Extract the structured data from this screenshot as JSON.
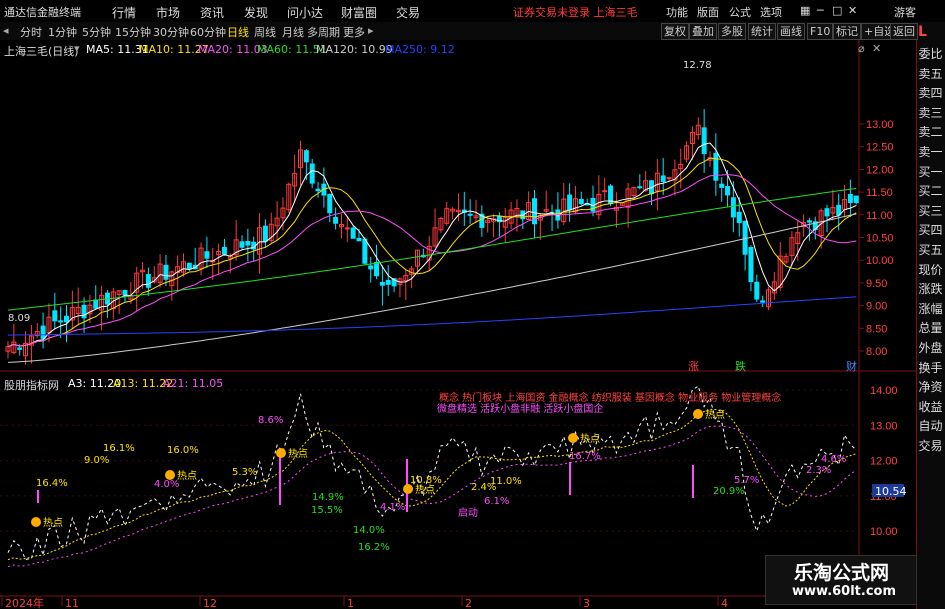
{
  "menubar": {
    "app_title": "通达信金融终端",
    "menus": [
      "行情",
      "市场",
      "资讯",
      "发现",
      "问小达",
      "财富圈",
      "交易"
    ],
    "warn": "证券交易未登录  上海三毛",
    "right": [
      "功能",
      "版面",
      "公式",
      "选项"
    ],
    "guest": "游客"
  },
  "periods": [
    "分时",
    "1分钟",
    "5分钟",
    "15分钟",
    "30分钟",
    "60分钟",
    "日线",
    "周线",
    "月线",
    "多周期",
    "更多"
  ],
  "active_period": "日线",
  "toolbar_right": [
    "复权",
    "叠加",
    "多股",
    "统计",
    "画线",
    "F10",
    "标记",
    "+自选",
    "返回"
  ],
  "side_panel": {
    "top_label": "L",
    "items": [
      "委比",
      "卖五",
      "卖四",
      "卖三",
      "卖二",
      "卖一",
      "买一",
      "买二",
      "买三",
      "买四",
      "买五",
      "现价",
      "涨跌",
      "涨幅",
      "总量",
      "外盘",
      "换手",
      "净资",
      "收益",
      "自动",
      "交易"
    ]
  },
  "main_chart": {
    "stock": "上海三毛(日线)",
    "ma_labels": [
      {
        "text": "MA5: 11.31",
        "color": "#ffffff"
      },
      {
        "text": "MA10: 11.27",
        "color": "#ffe100"
      },
      {
        "text": "MA20: 11.03",
        "color": "#ff4cff"
      },
      {
        "text": "MA60: 11.51",
        "color": "#22dd22"
      },
      {
        "text": "MA120: 10.99",
        "color": "#cccccc"
      },
      {
        "text": "MA250: 9.12",
        "color": "#2244ff"
      }
    ],
    "y_ticks": [
      "13.00",
      "12.50",
      "12.00",
      "11.50",
      "11.00",
      "10.50",
      "10.00",
      "9.50",
      "9.00",
      "8.50",
      "8.00"
    ],
    "high_label": "12.78",
    "low_label": "8.09",
    "markers": [
      "涨",
      "跌",
      "财"
    ]
  },
  "indicator": {
    "title": "股朋指标网",
    "labels": [
      {
        "text": "A3: 11.20",
        "color": "#ffffff"
      },
      {
        "text": "A13: 11.22",
        "color": "#ffe100"
      },
      {
        "text": "A21: 11.05",
        "color": "#ff4cff"
      }
    ],
    "y_ticks": [
      "14.00",
      "13.00",
      "12.00",
      "11.00",
      "10.00"
    ],
    "cursor_label": "10.54",
    "concept_text": "概念  热门板块 上海国资 金融概念 纺织服装 基因概念 物业服务 物业管理概念",
    "sub_text": "微盘精选 活跃小盘非融 活跃小盘国企",
    "pct_labels": [
      "16.4%",
      "9.0%",
      "16.1%",
      "16.0%",
      "4.0%",
      "5.3%",
      "8.6%",
      "14.9%",
      "15.5%",
      "14.0%",
      "16.2%",
      "4.1%",
      "10.8%",
      "6.1%",
      "2.4%",
      "11.0%",
      "16.7%",
      "5.7%",
      "20.9%",
      "4.6%",
      "2.3%"
    ],
    "hot_label": "热点",
    "start_label": "启动"
  },
  "date_axis": [
    "2024年",
    "11",
    "12",
    "1",
    "2",
    "3",
    "4"
  ],
  "watermark": {
    "title": "乐淘公式网",
    "url": "www.60lt.com"
  },
  "colors": {
    "up": "#ff3b3b",
    "down": "#00e5ff",
    "grid": "#7a1212"
  }
}
